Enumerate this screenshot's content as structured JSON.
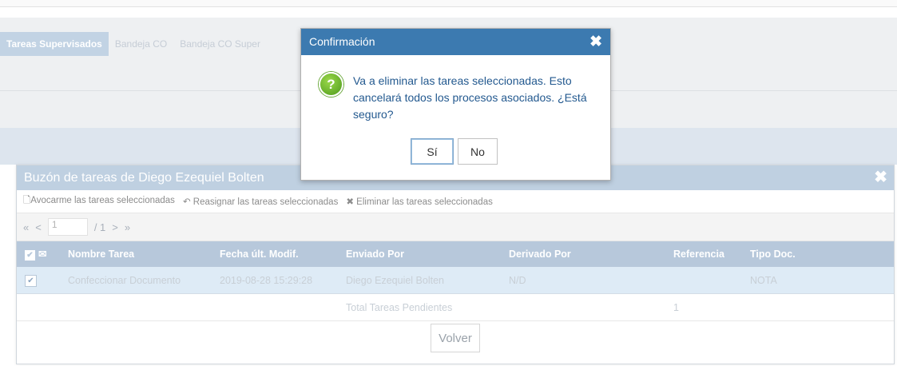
{
  "background": {
    "tabs": [
      {
        "label": "Tareas Supervisados",
        "active": true
      },
      {
        "label": "Bandeja CO",
        "active": false
      },
      {
        "label": "Bandeja CO Super",
        "active": false
      }
    ]
  },
  "inbox": {
    "title": "Buzón de tareas de Diego Ezequiel Bolten",
    "toolbar": {
      "take": "Avocarme las tareas seleccionadas",
      "reassign": "Reasignar las tareas seleccionadas",
      "delete": "Eliminar las tareas seleccionadas"
    },
    "pager": {
      "first": "«",
      "prev": "<",
      "page": "1",
      "total": "/ 1",
      "next": ">",
      "last": "»"
    },
    "columns": [
      "Nombre Tarea",
      "Fecha últ. Modif.",
      "Enviado Por",
      "Derivado Por",
      "Referencia",
      "Tipo Doc."
    ],
    "rows": [
      {
        "checked": true,
        "cells": [
          "Confeccionar Documento",
          "2019-08-28 15:29:28",
          "Diego Ezequiel Bolten",
          "N/D",
          "",
          "NOTA"
        ]
      }
    ],
    "total_label": "Total Tareas Pendientes",
    "total_value": "1",
    "back_button": "Volver"
  },
  "modal": {
    "title": "Confirmación",
    "message": "Va a eliminar las tareas seleccionadas. Esto cancelará todos los procesos asociados. ¿Está seguro?",
    "yes": "Sí",
    "no": "No"
  },
  "colors": {
    "modal_header": "#3c7ab0",
    "inbox_header": "#bfd0e1",
    "message_text": "#23598f",
    "selected_row": "#deebf6"
  }
}
